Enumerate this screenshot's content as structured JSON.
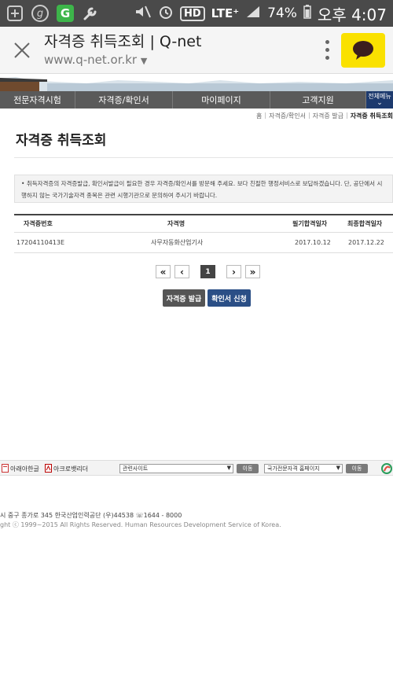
{
  "status_bar": {
    "icons": [
      "plus-box-icon",
      "circle-g-icon",
      "green-g-app-icon",
      "wrench-icon",
      "mute-icon",
      "alarm-icon"
    ],
    "hd": "HD",
    "lte": "LTE⁺",
    "battery": "74%",
    "time": "오후 4:07"
  },
  "browser": {
    "title": "자격증 취득조회 | Q-net",
    "url": "www.q-net.or.kr"
  },
  "nav": {
    "items": [
      "전문자격시험",
      "자격증/확인서",
      "마이페이지",
      "고객지원"
    ],
    "all_menu": "전체메뉴"
  },
  "breadcrumb": [
    "홈",
    "자격증/확인서",
    "자격증 발급",
    "자격증 취득조회"
  ],
  "page": {
    "heading": "자격증 취득조회",
    "notice": "취득자격증의 자격증발급, 확인서발급이 필요한 경우 자격증/확인서를 방문해 주세요. 보다 친절한 행정서비스로 보답하겠습니다. 단, 공단에서 시행하지 않는 국가기술자격 종목은 관련 시행기관으로 문의하여 주시기 바랍니다."
  },
  "table": {
    "headers": [
      "자격증번호",
      "자격명",
      "필기합격일자",
      "최종합격일자"
    ],
    "rows": [
      [
        "17204110413E",
        "사무자동화산업기사",
        "2017.10.12",
        "2017.12.22"
      ]
    ]
  },
  "pagination": {
    "first": "«",
    "prev": "‹",
    "current": "1",
    "next": "›",
    "last": "»"
  },
  "buttons": {
    "issue": "자격증 발급",
    "confirm": "확인서 신청"
  },
  "footer": {
    "hangul_viewer": "아래아한글",
    "acrobat": "아크로뱃리더",
    "related_select": "관련사이트",
    "go1": "이동",
    "national_select": "국가전문자격 홈페이지",
    "go2": "이동",
    "address": "시 중구 종가로 345 한국산업인력공단 (우)44538 ☏1644 - 8000",
    "copyright": "ght ⓒ 1999~2015 All Rights Reserved. Human Resources Development Service of Korea."
  }
}
